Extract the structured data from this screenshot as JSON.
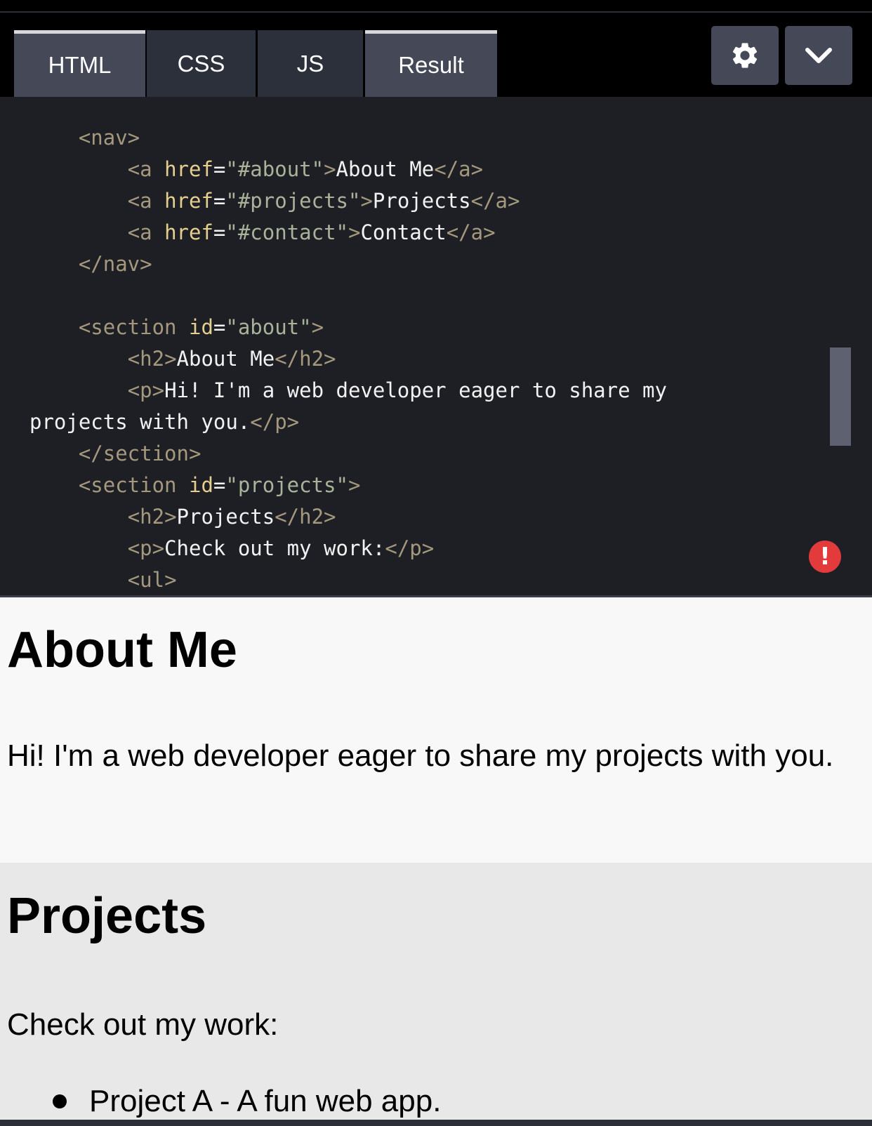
{
  "tabs": [
    {
      "label": "HTML"
    },
    {
      "label": "CSS"
    },
    {
      "label": "JS"
    },
    {
      "label": "Result"
    }
  ],
  "toolbar": {
    "settings_icon": "gear-icon",
    "collapse_icon": "chevron-down-icon"
  },
  "code": {
    "line1": "<nav>",
    "line2_open": "<a ",
    "line2_attr": "href",
    "line2_eq": "=",
    "line2_val": "\"#about\"",
    "line2_close": ">",
    "line2_text": "About Me",
    "line2_end": "</a>",
    "line3_open": "<a ",
    "line3_attr": "href",
    "line3_eq": "=",
    "line3_val": "\"#projects\"",
    "line3_close": ">",
    "line3_text": "Projects",
    "line3_end": "</a>",
    "line4_open": "<a ",
    "line4_attr": "href",
    "line4_eq": "=",
    "line4_val": "\"#contact\"",
    "line4_close": ">",
    "line4_text": "Contact",
    "line4_end": "</a>",
    "line5": "</nav>",
    "line7_open": "<section ",
    "line7_attr": "id",
    "line7_eq": "=",
    "line7_val": "\"about\"",
    "line7_close": ">",
    "line8_open": "<h2>",
    "line8_text": "About Me",
    "line8_end": "</h2>",
    "line9_open": "<p>",
    "line9_text": "Hi! I'm a web developer eager to share my",
    "line10_text": "projects with you.",
    "line10_end": "</p>",
    "line11": "</section>",
    "line12_open": "<section ",
    "line12_attr": "id",
    "line12_eq": "=",
    "line12_val": "\"projects\"",
    "line12_close": ">",
    "line13_open": "<h2>",
    "line13_text": "Projects",
    "line13_end": "</h2>",
    "line14_open": "<p>",
    "line14_text": "Check out my work:",
    "line14_end": "</p>",
    "line15": "<ul>"
  },
  "error_badge": "!",
  "preview": {
    "about_heading": "About Me",
    "about_text": "Hi! I'm a web developer eager to share my projects with you.",
    "projects_heading": "Projects",
    "projects_text": "Check out my work:",
    "projects_items": [
      "Project A - A fun web app."
    ]
  },
  "colors": {
    "tag": "#a4987d",
    "attr": "#e4cf8f",
    "string": "#a9b39a",
    "error": "#e33b3b"
  }
}
